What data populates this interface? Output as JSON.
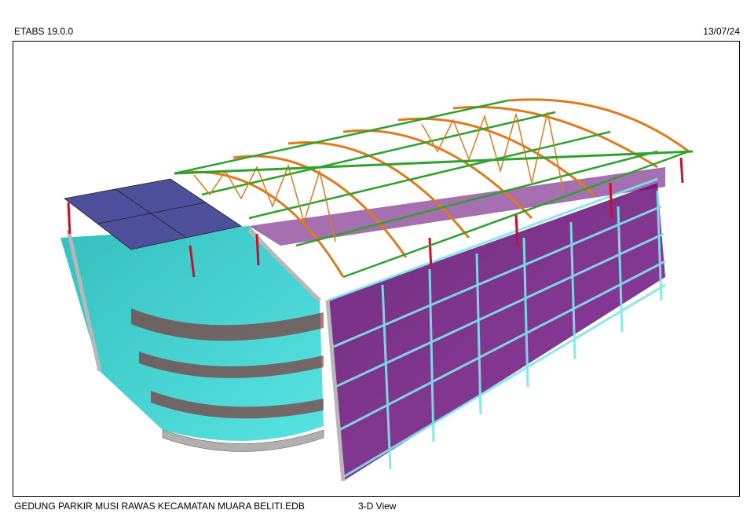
{
  "header": {
    "app_version": "ETABS 19.0.0",
    "date": "13/07/24"
  },
  "footer": {
    "model_file": "GEDUNG PARKIR MUSI RAWAS KECAMATAN MUARA BELITI.EDB",
    "view_name": "3-D View"
  },
  "colors": {
    "slab_purple": "#6a0f7a",
    "slab_cyan": "#2ed1cf",
    "roof_panel": "#4d4f9a",
    "column_gray": "#b8b8b8",
    "beam_cyan": "#7fe6e8",
    "column_red": "#c8102e",
    "truss_orange": "#e07a1c",
    "purlin_green": "#2ea12e"
  }
}
